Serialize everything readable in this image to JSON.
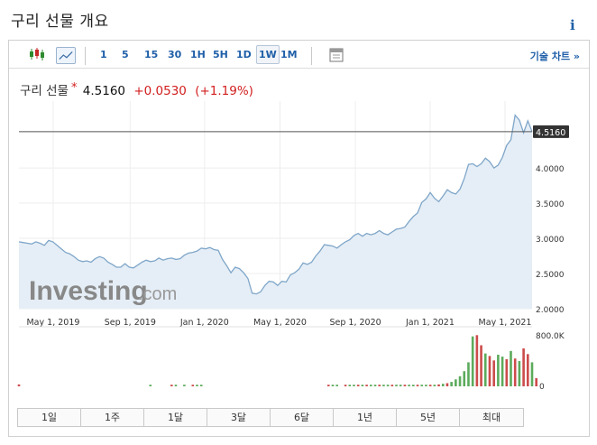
{
  "header": {
    "title": "구리 선물 개요",
    "info_icon": "info-icon"
  },
  "toolbar": {
    "timeframes": [
      "1",
      "5",
      "15",
      "30",
      "1H",
      "5H",
      "1D",
      "1W",
      "1M"
    ],
    "active_timeframe": "1W",
    "tech_chart_link": "기술 차트 »",
    "icons": [
      "candlestick-icon",
      "line-chart-icon",
      "calendar-icon"
    ]
  },
  "quote": {
    "name": "구리 선물",
    "marker": "*",
    "price": "4.5160",
    "change": "+0.0530",
    "change_pct": "(+1.19%)"
  },
  "watermark": {
    "brand": "Investing",
    "suffix": ".com"
  },
  "range_buttons": [
    "1일",
    "1주",
    "1달",
    "3달",
    "6달",
    "1년",
    "5년",
    "최대"
  ],
  "colors": {
    "link": "#1f5fa8",
    "down": "#d21e1e",
    "line": "#7fa6c9",
    "area": "#e5eef6",
    "vol_up": "#5cab5c",
    "vol_down": "#cc4b4b"
  },
  "chart_data": {
    "type": "area",
    "title": "",
    "xlabel": "",
    "ylabel": "",
    "x_tick_labels": [
      "May 1, 2019",
      "Sep 1, 2019",
      "Jan 1, 2020",
      "May 1, 2020",
      "Sep 1, 2020",
      "Jan 1, 2021",
      "May 1, 2021"
    ],
    "y_tick_labels": [
      "4.0000",
      "3.5000",
      "3.0000",
      "2.5000",
      "2.0000"
    ],
    "ylim": [
      2.0,
      4.95
    ],
    "last_price_label": "4.5160",
    "grid": true,
    "series": [
      {
        "values": [
          2.95,
          2.94,
          2.93,
          2.92,
          2.95,
          2.93,
          2.9,
          2.97,
          2.95,
          2.9,
          2.85,
          2.8,
          2.78,
          2.74,
          2.69,
          2.67,
          2.68,
          2.66,
          2.71,
          2.74,
          2.72,
          2.66,
          2.63,
          2.59,
          2.59,
          2.64,
          2.59,
          2.58,
          2.62,
          2.66,
          2.69,
          2.67,
          2.68,
          2.72,
          2.69,
          2.71,
          2.72,
          2.7,
          2.71,
          2.76,
          2.79,
          2.8,
          2.82,
          2.86,
          2.85,
          2.87,
          2.84,
          2.83,
          2.7,
          2.61,
          2.51,
          2.59,
          2.57,
          2.51,
          2.43,
          2.22,
          2.21,
          2.24,
          2.33,
          2.39,
          2.38,
          2.33,
          2.39,
          2.38,
          2.48,
          2.51,
          2.56,
          2.65,
          2.63,
          2.66,
          2.75,
          2.82,
          2.91,
          2.9,
          2.89,
          2.86,
          2.91,
          2.95,
          2.98,
          3.04,
          3.07,
          3.03,
          3.07,
          3.05,
          3.07,
          3.11,
          3.07,
          3.05,
          3.09,
          3.13,
          3.14,
          3.16,
          3.24,
          3.31,
          3.36,
          3.51,
          3.56,
          3.65,
          3.57,
          3.52,
          3.6,
          3.69,
          3.65,
          3.63,
          3.7,
          3.85,
          4.05,
          4.06,
          4.02,
          4.06,
          4.14,
          4.09,
          4.0,
          4.04,
          4.15,
          4.32,
          4.4,
          4.75,
          4.68,
          4.5,
          4.67,
          4.516
        ]
      }
    ],
    "volume": {
      "axis_labels": [
        "800.0K",
        "0"
      ],
      "ylim": [
        0,
        800000
      ],
      "bars": [
        {
          "i": 0,
          "v": 30000,
          "up": false
        },
        {
          "i": 31,
          "v": 25000,
          "up": true
        },
        {
          "i": 36,
          "v": 25000,
          "up": false
        },
        {
          "i": 37,
          "v": 25000,
          "up": true
        },
        {
          "i": 39,
          "v": 25000,
          "up": true
        },
        {
          "i": 41,
          "v": 25000,
          "up": false
        },
        {
          "i": 42,
          "v": 25000,
          "up": true
        },
        {
          "i": 43,
          "v": 25000,
          "up": true
        },
        {
          "i": 73,
          "v": 25000,
          "up": false
        },
        {
          "i": 74,
          "v": 25000,
          "up": true
        },
        {
          "i": 75,
          "v": 25000,
          "up": true
        },
        {
          "i": 77,
          "v": 25000,
          "up": false
        },
        {
          "i": 78,
          "v": 25000,
          "up": true
        },
        {
          "i": 79,
          "v": 25000,
          "up": true
        },
        {
          "i": 80,
          "v": 25000,
          "up": false
        },
        {
          "i": 81,
          "v": 25000,
          "up": true
        },
        {
          "i": 82,
          "v": 25000,
          "up": false
        },
        {
          "i": 83,
          "v": 25000,
          "up": true
        },
        {
          "i": 84,
          "v": 25000,
          "up": true
        },
        {
          "i": 85,
          "v": 25000,
          "up": false
        },
        {
          "i": 86,
          "v": 25000,
          "up": true
        },
        {
          "i": 87,
          "v": 25000,
          "up": true
        },
        {
          "i": 88,
          "v": 25000,
          "up": false
        },
        {
          "i": 89,
          "v": 25000,
          "up": true
        },
        {
          "i": 90,
          "v": 25000,
          "up": true
        },
        {
          "i": 91,
          "v": 25000,
          "up": false
        },
        {
          "i": 92,
          "v": 25000,
          "up": true
        },
        {
          "i": 93,
          "v": 25000,
          "up": true
        },
        {
          "i": 94,
          "v": 25000,
          "up": false
        },
        {
          "i": 95,
          "v": 25000,
          "up": true
        },
        {
          "i": 96,
          "v": 25000,
          "up": true
        },
        {
          "i": 97,
          "v": 25000,
          "up": false
        },
        {
          "i": 98,
          "v": 25000,
          "up": true
        },
        {
          "i": 99,
          "v": 30000,
          "up": false
        },
        {
          "i": 100,
          "v": 40000,
          "up": true
        },
        {
          "i": 101,
          "v": 50000,
          "up": false
        },
        {
          "i": 102,
          "v": 70000,
          "up": true
        },
        {
          "i": 103,
          "v": 110000,
          "up": true
        },
        {
          "i": 104,
          "v": 160000,
          "up": true
        },
        {
          "i": 105,
          "v": 240000,
          "up": true
        },
        {
          "i": 106,
          "v": 380000,
          "up": true
        },
        {
          "i": 107,
          "v": 790000,
          "up": true
        },
        {
          "i": 108,
          "v": 810000,
          "up": false
        },
        {
          "i": 109,
          "v": 650000,
          "up": false
        },
        {
          "i": 110,
          "v": 520000,
          "up": true
        },
        {
          "i": 111,
          "v": 480000,
          "up": false
        },
        {
          "i": 112,
          "v": 410000,
          "up": false
        },
        {
          "i": 113,
          "v": 500000,
          "up": true
        },
        {
          "i": 114,
          "v": 470000,
          "up": true
        },
        {
          "i": 115,
          "v": 430000,
          "up": false
        },
        {
          "i": 116,
          "v": 560000,
          "up": true
        },
        {
          "i": 117,
          "v": 440000,
          "up": false
        },
        {
          "i": 118,
          "v": 400000,
          "up": true
        },
        {
          "i": 119,
          "v": 600000,
          "up": false
        },
        {
          "i": 120,
          "v": 510000,
          "up": false
        },
        {
          "i": 121,
          "v": 380000,
          "up": true
        },
        {
          "i": 122,
          "v": 130000,
          "up": false
        }
      ]
    }
  }
}
